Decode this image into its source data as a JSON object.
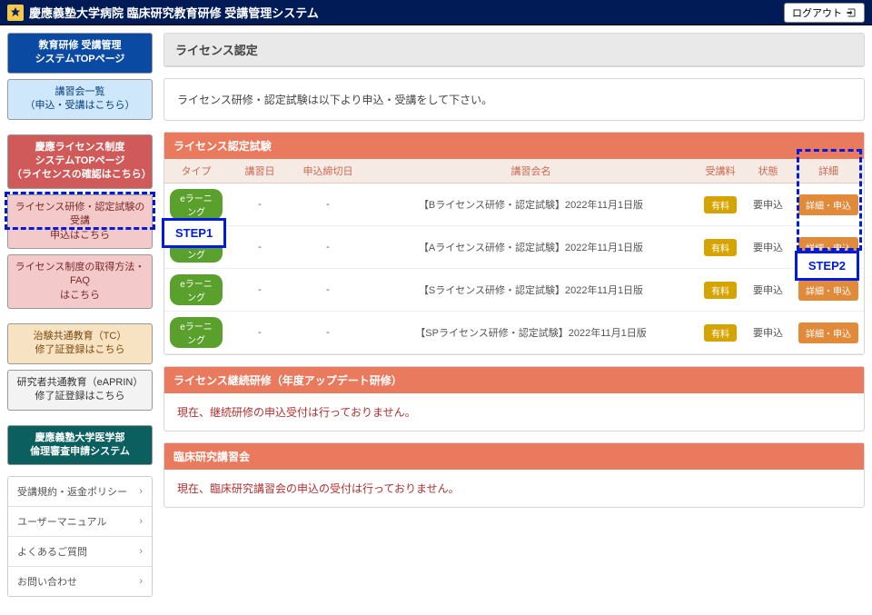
{
  "header": {
    "site_title": "慶應義塾大学病院 臨床研究教育研修 受講管理システム",
    "logout_label": "ログアウト"
  },
  "sidebar": {
    "btn_top_blue": "教育研修 受講管理\nシステムTOPページ",
    "btn_course_list": "講習会一覧\n（申込・受講はこちら）",
    "btn_top_pink": "慶應ライセンス制度\nシステムTOPページ\n（ライセンスの確認はこちら）",
    "btn_lic_apply": "ライセンス研修・認定試験の受講\n申込はこちら",
    "btn_lic_faq": "ライセンス制度の取得方法・FAQ\nはこちら",
    "btn_tc": "治験共通教育（TC）\n修了証登録はこちら",
    "btn_eaprin": "研究者共通教育（eAPRIN）\n修了証登録はこちら",
    "btn_irb": "慶應義塾大学医学部\n倫理審査申請システム",
    "links": [
      "受講規約・返金ポリシー",
      "ユーザーマニュアル",
      "よくあるご質問",
      "お問い合わせ"
    ]
  },
  "main": {
    "page_title": "ライセンス認定",
    "intro": "ライセンス研修・認定試験は以下より申込・受講をして下さい。",
    "section_exam": "ライセンス認定試験",
    "section_cont": "ライセンス継続研修（年度アップデート研修）",
    "section_cont_msg": "現在、継続研修の申込受付は行っておりません。",
    "section_clin": "臨床研究講習会",
    "section_clin_msg": "現在、臨床研究講習会の申込の受付は行っておりません。",
    "columns": {
      "type": "タイプ",
      "date": "講習日",
      "deadline": "申込締切日",
      "name": "講習会名",
      "fee": "受講料",
      "status": "状態",
      "detail": "詳細"
    },
    "rows": [
      {
        "type": "eラーニング",
        "date": "-",
        "deadline": "-",
        "name": "【Bライセンス研修・認定試験】2022年11月1日版",
        "fee": "有料",
        "status": "要申込",
        "detail": "詳細・申込"
      },
      {
        "type": "eラーニング",
        "date": "-",
        "deadline": "-",
        "name": "【Aライセンス研修・認定試験】2022年11月1日版",
        "fee": "有料",
        "status": "要申込",
        "detail": "詳細・申込"
      },
      {
        "type": "eラーニング",
        "date": "-",
        "deadline": "-",
        "name": "【Sライセンス研修・認定試験】2022年11月1日版",
        "fee": "有料",
        "status": "要申込",
        "detail": "詳細・申込"
      },
      {
        "type": "eラーニング",
        "date": "-",
        "deadline": "-",
        "name": "【SPライセンス研修・認定試験】2022年11月1日版",
        "fee": "有料",
        "status": "要申込",
        "detail": "詳細・申込"
      }
    ]
  },
  "annotations": {
    "step1": "STEP1",
    "step2": "STEP2"
  }
}
